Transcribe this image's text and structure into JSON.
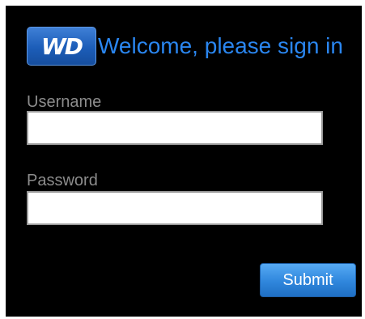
{
  "header": {
    "logo_icon": "wd-logo-icon",
    "logo_text": "WD",
    "welcome_text": "Welcome, please sign in"
  },
  "form": {
    "username_label": "Username",
    "username_value": "",
    "password_label": "Password",
    "password_value": "",
    "submit_label": "Submit"
  },
  "colors": {
    "background": "#000000",
    "accent": "#2a86f0",
    "label": "#8c8c8c",
    "button": "#2f86dc"
  }
}
